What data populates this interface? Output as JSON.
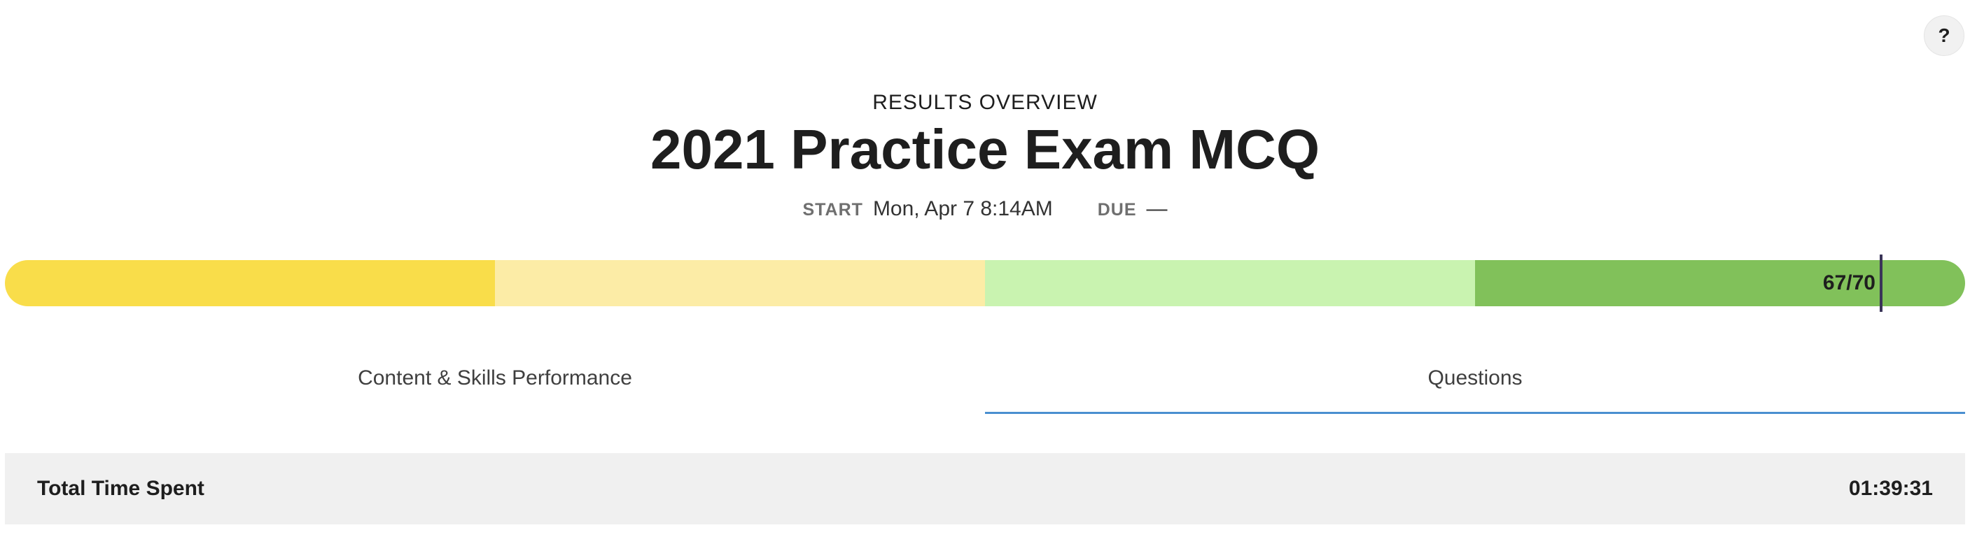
{
  "help": {
    "label": "?"
  },
  "header": {
    "eyebrow": "RESULTS OVERVIEW",
    "title": "2021 Practice Exam MCQ"
  },
  "meta": {
    "start_label": "START",
    "start_value": "Mon, Apr 7 8:14AM",
    "due_label": "DUE",
    "due_value": "—"
  },
  "score": {
    "correct": 67,
    "total": 70,
    "label": "67/70",
    "segment_colors": [
      "#f9dd4a",
      "#fceca6",
      "#c9f3b0",
      "#81c15a"
    ]
  },
  "tabs": [
    {
      "label": "Content & Skills Performance",
      "active": false
    },
    {
      "label": "Questions",
      "active": true
    }
  ],
  "time_spent": {
    "label": "Total Time Spent",
    "value": "01:39:31"
  },
  "colors": {
    "tab_active_underline": "#4a8fd0",
    "marker": "#3a3458"
  }
}
